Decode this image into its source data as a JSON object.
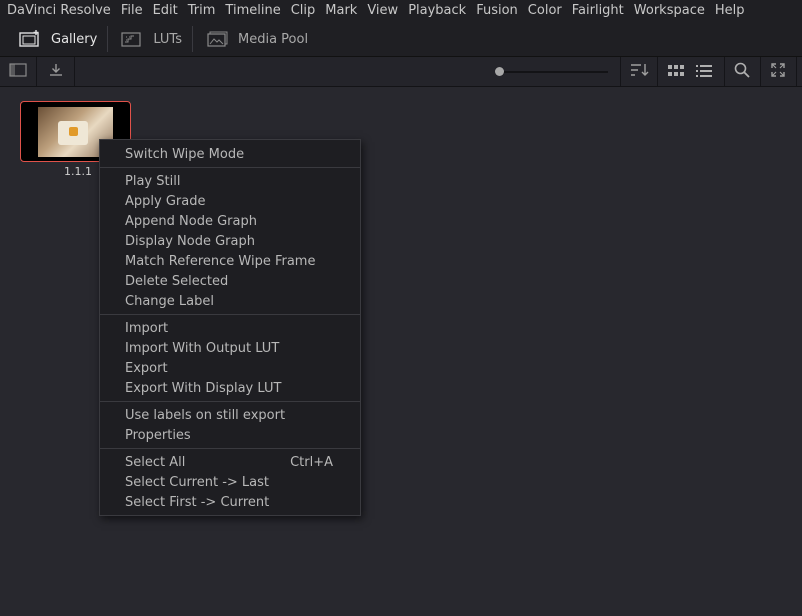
{
  "menubar": {
    "items": [
      "DaVinci Resolve",
      "File",
      "Edit",
      "Trim",
      "Timeline",
      "Clip",
      "Mark",
      "View",
      "Playback",
      "Fusion",
      "Color",
      "Fairlight",
      "Workspace",
      "Help"
    ]
  },
  "tabs": {
    "gallery": {
      "label": "Gallery",
      "icon": "gallery-icon"
    },
    "luts": {
      "label": "LUTs",
      "icon": "luts-icon"
    },
    "media_pool": {
      "label": "Media Pool",
      "icon": "media-pool-icon"
    }
  },
  "toolbar": {
    "icons": [
      "sidebar-toggle-icon",
      "download-icon",
      "sort-icon",
      "grid-view-icon",
      "list-view-icon",
      "search-icon",
      "expand-icon"
    ]
  },
  "still": {
    "label": "1.1.1",
    "border_color": "#e0524a"
  },
  "context_menu": {
    "switch_wipe_mode": "Switch Wipe Mode",
    "play_still": "Play Still",
    "apply_grade": "Apply Grade",
    "append_node_graph": "Append Node Graph",
    "display_node_graph": "Display Node Graph",
    "match_reference_wipe_frame": "Match Reference Wipe Frame",
    "delete_selected": "Delete Selected",
    "change_label": "Change Label",
    "import": "Import",
    "import_with_output_lut": "Import With Output LUT",
    "export": "Export",
    "export_with_display_lut": "Export With Display LUT",
    "use_labels": "Use labels on still export",
    "properties": "Properties",
    "select_all": "Select All",
    "select_all_shortcut": "Ctrl+A",
    "select_current_last": "Select Current -> Last",
    "select_first_current": "Select First -> Current"
  }
}
